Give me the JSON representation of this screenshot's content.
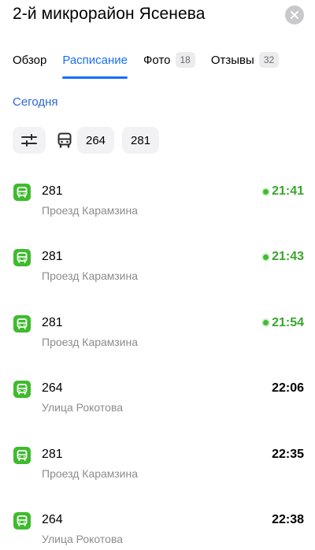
{
  "header": {
    "title": "2-й микрорайон Ясенева"
  },
  "tabs": [
    {
      "label": "Обзор",
      "badge": "",
      "active": false
    },
    {
      "label": "Расписание",
      "badge": "",
      "active": true
    },
    {
      "label": "Фото",
      "badge": "18",
      "active": false
    },
    {
      "label": "Отзывы",
      "badge": "32",
      "active": false
    }
  ],
  "schedule": {
    "date_label": "Сегодня",
    "route_filters": [
      "264",
      "281"
    ]
  },
  "departures": [
    {
      "route": "281",
      "stop": "Проезд Карамзина",
      "time": "21:41",
      "realtime": true
    },
    {
      "route": "281",
      "stop": "Проезд Карамзина",
      "time": "21:43",
      "realtime": true
    },
    {
      "route": "281",
      "stop": "Проезд Карамзина",
      "time": "21:54",
      "realtime": true
    },
    {
      "route": "264",
      "stop": "Улица Рокотова",
      "time": "22:06",
      "realtime": false
    },
    {
      "route": "281",
      "stop": "Проезд Карамзина",
      "time": "22:35",
      "realtime": false
    },
    {
      "route": "264",
      "stop": "Улица Рокотова",
      "time": "22:38",
      "realtime": false
    }
  ],
  "colors": {
    "accent": "#196dff",
    "link": "#2a6ad6",
    "bus_green": "#3fbb2e",
    "realtime_green": "#3aa62d"
  },
  "icons": {
    "close": "close-icon",
    "filter": "filter-sliders-icon",
    "bus": "bus-icon"
  }
}
